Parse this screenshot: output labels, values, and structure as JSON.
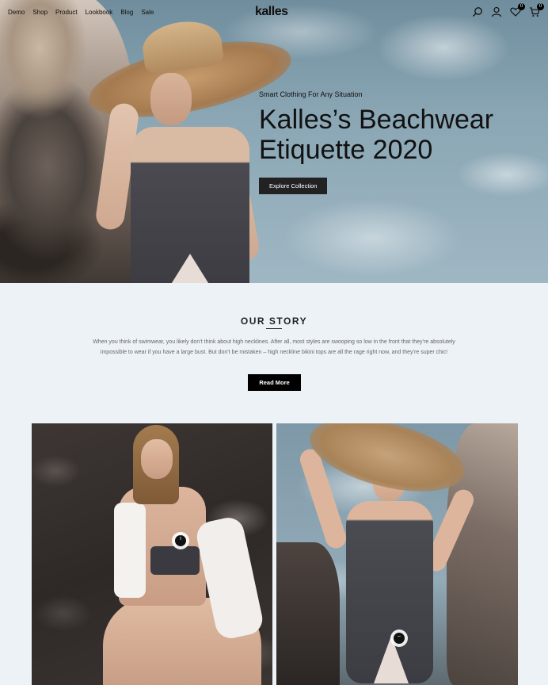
{
  "nav": {
    "links": [
      "Demo",
      "Shop",
      "Product",
      "Lookbook",
      "Blog",
      "Sale"
    ],
    "logo": "kalles",
    "wishlist_count": "0",
    "cart_count": "0"
  },
  "hero": {
    "kicker": "Smart Clothing For Any Situation",
    "title_line1": "Kalles’s Beachwear",
    "title_line2": "Etiquette 2020",
    "button": "Explore Collection"
  },
  "story": {
    "title": "OUR STORY",
    "text": "When you think of swimwear, you likely don’t think about high necklines. After all, most styles are swooping so low in the front that they’re absolutely impossible to wear if you have a large bust. But don’t be mistaken – high neckline bikini tops are all the rage right now, and they’re super chic!",
    "button": "Read More"
  },
  "gallery": {
    "hotspot_left": "i",
    "hotspot_right": "–"
  },
  "colors": {
    "page_bg": "#edf2f7",
    "button_dark": "#222222",
    "text_muted": "#666666"
  }
}
